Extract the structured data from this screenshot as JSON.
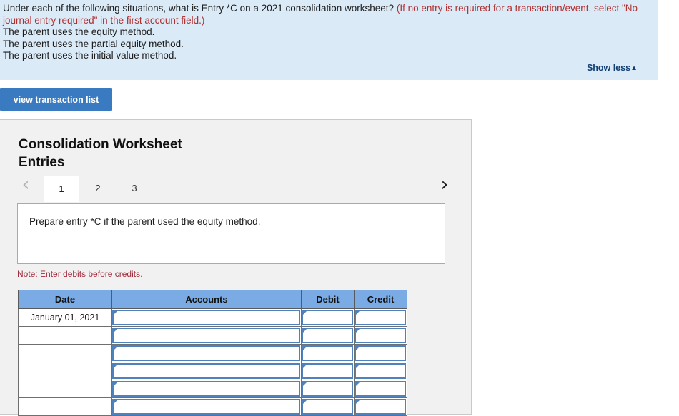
{
  "question": {
    "prompt_main": "Under each of the following situations, what is Entry *C on a 2021 consolidation worksheet? ",
    "prompt_hint": "(If no entry is required for a transaction/event, select \"No journal entry required\" in the first account field.)",
    "situations": [
      "The parent uses the equity method.",
      "The parent uses the partial equity method.",
      "The parent uses the initial value method."
    ],
    "show_less_label": "Show less",
    "show_less_caret": "▲"
  },
  "toolbar": {
    "view_transaction_list_label": "view transaction list"
  },
  "worksheet": {
    "title": "Consolidation Worksheet Entries",
    "prev_icon": "‹",
    "next_icon": "›",
    "tabs": [
      {
        "label": "1",
        "active": true
      },
      {
        "label": "2",
        "active": false
      },
      {
        "label": "3",
        "active": false
      }
    ],
    "instruction": "Prepare entry *C if the parent used the equity method.",
    "note": "Note: Enter debits before credits.",
    "table": {
      "headers": [
        "Date",
        "Accounts",
        "Debit",
        "Credit"
      ],
      "rows": [
        {
          "date": "January 01, 2021",
          "account": "",
          "debit": "",
          "credit": ""
        },
        {
          "date": "",
          "account": "",
          "debit": "",
          "credit": ""
        },
        {
          "date": "",
          "account": "",
          "debit": "",
          "credit": ""
        },
        {
          "date": "",
          "account": "",
          "debit": "",
          "credit": ""
        },
        {
          "date": "",
          "account": "",
          "debit": "",
          "credit": ""
        },
        {
          "date": "",
          "account": "",
          "debit": "",
          "credit": ""
        }
      ]
    }
  },
  "colors": {
    "banner_bg": "#daeaf7",
    "accent_blue": "#3a7ac0",
    "header_blue": "#7aabe4",
    "input_border": "#4f81bd",
    "note_red": "#a02c3c",
    "hint_red": "#b03030"
  }
}
